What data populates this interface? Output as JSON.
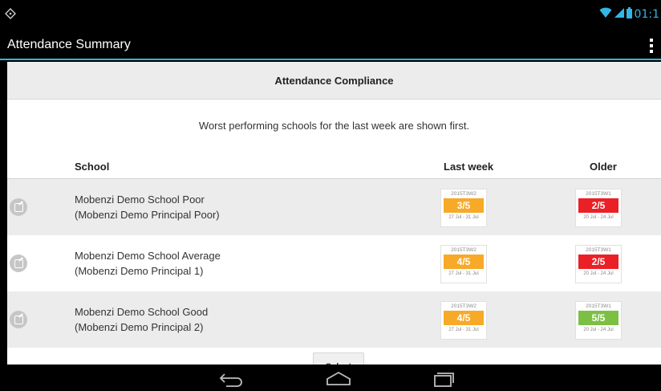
{
  "status_bar": {
    "time": "01:1",
    "icons": [
      "location-icon",
      "wifi-icon",
      "signal-icon",
      "battery-icon"
    ]
  },
  "action_bar": {
    "title": "Attendance Summary",
    "overflow_icon": "overflow-menu-icon"
  },
  "section": {
    "title": "Attendance Compliance",
    "subtitle": "Worst performing schools for the last week are shown first."
  },
  "table": {
    "columns": {
      "school": "School",
      "last_week": "Last week",
      "older": "Older"
    },
    "rows": [
      {
        "name": "Mobenzi Demo School Poor",
        "principal": "(Mobenzi Demo Principal Poor)",
        "last_week": {
          "code": "2015T3W2",
          "score": "3/5",
          "range": "27 Jul - 31 Jul",
          "color": "#f7a928"
        },
        "older": {
          "code": "2015T3W1",
          "score": "2/5",
          "range": "20 Jul - 24 Jul",
          "color": "#eb2026"
        }
      },
      {
        "name": "Mobenzi Demo School Average",
        "principal": "(Mobenzi Demo Principal 1)",
        "last_week": {
          "code": "2015T3W2",
          "score": "4/5",
          "range": "27 Jul - 31 Jul",
          "color": "#f7a928"
        },
        "older": {
          "code": "2015T3W1",
          "score": "2/5",
          "range": "20 Jul - 24 Jul",
          "color": "#eb2026"
        }
      },
      {
        "name": "Mobenzi Demo School Good",
        "principal": "(Mobenzi Demo Principal 2)",
        "last_week": {
          "code": "2015T3W2",
          "score": "4/5",
          "range": "27 Jul - 31 Jul",
          "color": "#f7a928"
        },
        "older": {
          "code": "2015T3W1",
          "score": "5/5",
          "range": "20 Jul - 24 Jul",
          "color": "#7cc043"
        }
      }
    ]
  },
  "footer_button": {
    "label": "Select"
  },
  "colors": {
    "accent": "#33b5e5",
    "orange": "#f7a928",
    "red": "#eb2026",
    "green": "#7cc043"
  },
  "nav_bar": {
    "icons": [
      "back-icon",
      "home-icon",
      "recents-icon"
    ]
  }
}
